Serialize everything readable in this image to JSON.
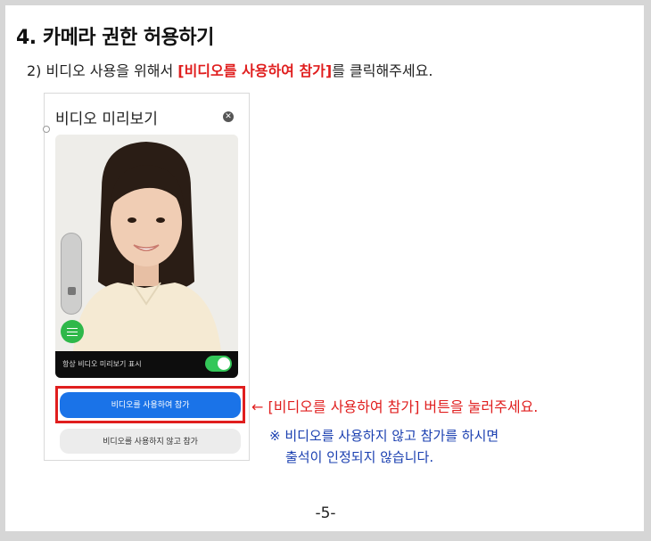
{
  "section": {
    "title": "4. 카메라 권한 허용하기"
  },
  "instruction": {
    "prefix": "2) 비디오 사용을 위해서 ",
    "highlight": "[비디오를 사용하여 참가]",
    "suffix": "를 클릭해주세요."
  },
  "dialog": {
    "title": "비디오 미리보기",
    "footer_label": "항상 비디오 미리보기 표시",
    "toggle_on": true,
    "join_button": "비디오를 사용하여 참가",
    "join_without_video_button": "비디오를 사용하지 않고 참가"
  },
  "annotation": {
    "arrow_note": "← [비디오를 사용하여 참가] 버튼을 눌러주세요.",
    "note_line1": "※ 비디오를 사용하지 않고 참가를 하시면",
    "note_line2": "출석이 인정되지 않습니다."
  },
  "page_number": "-5-",
  "colors": {
    "highlight_red": "#e01e1e",
    "note_blue": "#1a3fb0",
    "button_blue": "#1a73e8",
    "toggle_green": "#34c759"
  }
}
